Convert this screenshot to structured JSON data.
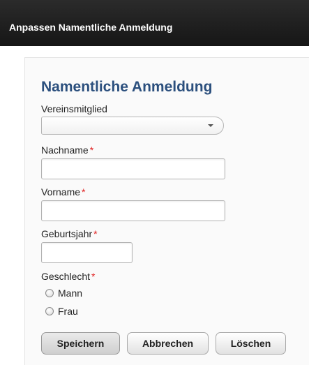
{
  "window": {
    "title": "Anpassen Namentliche Anmeldung"
  },
  "form": {
    "title": "Namentliche Anmeldung",
    "required_marker": "*",
    "fields": {
      "member": {
        "label": "Vereinsmitglied",
        "value": ""
      },
      "lastname": {
        "label": "Nachname",
        "value": ""
      },
      "firstname": {
        "label": "Vorname",
        "value": ""
      },
      "birthyear": {
        "label": "Geburtsjahr",
        "value": ""
      },
      "gender": {
        "label": "Geschlecht",
        "options": [
          "Mann",
          "Frau"
        ]
      }
    },
    "buttons": {
      "save": "Speichern",
      "cancel": "Abbrechen",
      "delete": "Löschen"
    }
  },
  "colors": {
    "titlebar": "#1e1e1e",
    "form_title": "#2b4f7d",
    "required": "#e02020"
  }
}
